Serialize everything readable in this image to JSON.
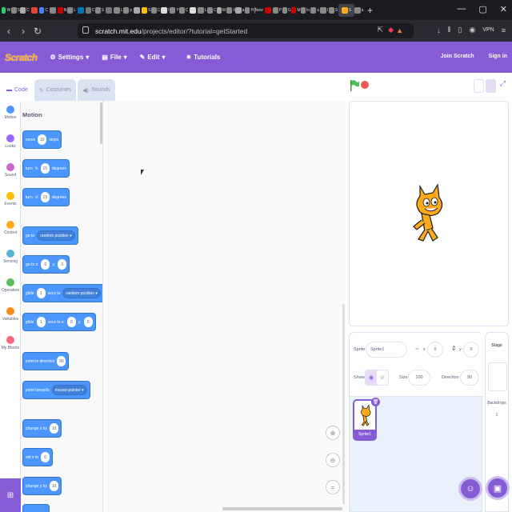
{
  "browser": {
    "tabs": [
      {
        "icon": "whatsapp-icon",
        "color": "#25d366",
        "label": "W"
      },
      {
        "icon": "tab-icon",
        "color": "#888888",
        "label": "S"
      },
      {
        "icon": "tab-icon",
        "color": "#aaaaaa",
        "label": "C"
      },
      {
        "icon": "google-icon",
        "color": "#ea4335",
        "label": ""
      },
      {
        "icon": "tab-icon",
        "color": "#4285f4",
        "label": "C"
      },
      {
        "icon": "tab-icon",
        "color": "#888888",
        "label": ""
      },
      {
        "icon": "tab-icon",
        "color": "#cc0000",
        "label": "N"
      },
      {
        "icon": "tab-icon",
        "color": "#888888",
        "label": "L"
      },
      {
        "icon": "tab-icon",
        "color": "#0077b5",
        "label": ""
      },
      {
        "icon": "tab-icon",
        "color": "#777777",
        "label": "C"
      },
      {
        "icon": "tab-icon",
        "color": "#888888",
        "label": "S"
      },
      {
        "icon": "tab-icon",
        "color": "#777777",
        "label": ""
      },
      {
        "icon": "tab-icon",
        "color": "#888888",
        "label": "L"
      },
      {
        "icon": "tab-icon",
        "color": "#888888",
        "label": "p"
      },
      {
        "icon": "tab-icon",
        "color": "#aaaaaa",
        "label": ""
      },
      {
        "icon": "tab-icon",
        "color": "#f7c600",
        "label": "S"
      },
      {
        "icon": "tab-icon",
        "color": "#888888",
        "label": "C"
      },
      {
        "icon": "tab-icon",
        "color": "#dddddd",
        "label": "I"
      },
      {
        "icon": "tab-icon",
        "color": "#888888",
        "label": "Y"
      },
      {
        "icon": "tab-icon",
        "color": "#888888",
        "label": "C"
      },
      {
        "icon": "github-icon",
        "color": "#dddddd",
        "label": ""
      },
      {
        "icon": "tab-icon",
        "color": "#888888",
        "label": "L"
      },
      {
        "icon": "tab-icon",
        "color": "#888888",
        "label": "C"
      },
      {
        "icon": "tab-icon",
        "color": "#aaaaaa",
        "label": "M"
      },
      {
        "icon": "tab-icon",
        "color": "#888888",
        "label": "li"
      },
      {
        "icon": "tab-icon",
        "color": "#aaaaaa",
        "label": "a"
      },
      {
        "icon": "tab-icon",
        "color": "#888888",
        "label": "H"
      },
      {
        "icon": "tab-icon",
        "color": "#888888",
        "label": "New"
      },
      {
        "icon": "tab-icon",
        "color": "#cc0000",
        "label": ""
      },
      {
        "icon": "tab-icon",
        "color": "#888888",
        "label": "P"
      },
      {
        "icon": "tab-icon",
        "color": "#888888",
        "label": "G"
      },
      {
        "icon": "tab-icon",
        "color": "#cc0000",
        "label": "M"
      },
      {
        "icon": "tab-icon",
        "color": "#888888",
        "label": "In"
      },
      {
        "icon": "tab-icon",
        "color": "#888888",
        "label": "a"
      },
      {
        "icon": "tab-icon",
        "color": "#888888",
        "label": "I"
      },
      {
        "icon": "tab-icon",
        "color": "#888888",
        "label": "S"
      }
    ],
    "active_tab": {
      "icon": "scratch-icon",
      "color": "#ffab19",
      "label": "S"
    },
    "after_tabs": [
      {
        "icon": "tab-icon",
        "color": "#888888",
        "label": "a"
      }
    ],
    "new_tab": "+",
    "url_domain": "scratch.mit.edu",
    "url_path": "/projects/editor/?tutorial=getStarted",
    "vpn": "VPN"
  },
  "menubar": {
    "logo": "Scratch",
    "settings": "Settings",
    "file": "File",
    "edit": "Edit",
    "tutorials": "Tutorials",
    "join": "Join Scratch",
    "signin": "Sign in"
  },
  "editor_tabs": {
    "code": "Code",
    "costumes": "Costumes",
    "sounds": "Sounds"
  },
  "categories": [
    {
      "label": "Motion",
      "color": "#4c97ff"
    },
    {
      "label": "Looks",
      "color": "#9966ff"
    },
    {
      "label": "Sound",
      "color": "#cf63cf"
    },
    {
      "label": "Events",
      "color": "#ffbf00"
    },
    {
      "label": "Control",
      "color": "#ffab19"
    },
    {
      "label": "Sensing",
      "color": "#5cb1d6"
    },
    {
      "label": "Operators",
      "color": "#59c059"
    },
    {
      "label": "Variables",
      "color": "#ff8c1a"
    },
    {
      "label": "My Blocks",
      "color": "#ff6680"
    }
  ],
  "palette": {
    "title": "Motion",
    "move": {
      "a": "move",
      "n": "10",
      "b": "steps"
    },
    "turn_right": {
      "a": "turn",
      "n": "15",
      "b": "degrees"
    },
    "turn_left": {
      "a": "turn",
      "n": "15",
      "b": "degrees"
    },
    "goto": {
      "a": "go to",
      "dd": "random position ▾"
    },
    "goto_xy": {
      "a": "go to x:",
      "x": "0",
      "b": "y:",
      "y": "0"
    },
    "glide_to": {
      "a": "glide",
      "n": "1",
      "b": "secs to",
      "dd": "random position ▾"
    },
    "glide_xy": {
      "a": "glide",
      "n": "1",
      "b": "secs to x:",
      "x": "0",
      "c": "y:",
      "y": "0"
    },
    "point_dir": {
      "a": "point in direction",
      "n": "90"
    },
    "point_towards": {
      "a": "point towards",
      "dd": "mouse-pointer ▾"
    },
    "change_x": {
      "a": "change x by",
      "n": "10"
    },
    "set_x": {
      "a": "set x to",
      "n": "0"
    },
    "change_y": {
      "a": "change y by",
      "n": "10"
    }
  },
  "sprite_info": {
    "sprite_label": "Sprite",
    "sprite_name": "Sprite1",
    "x_label": "x",
    "x": "0",
    "y_label": "y",
    "y": "0",
    "show_label": "Show",
    "size_label": "Size",
    "size": "100",
    "direction_label": "Direction",
    "direction": "90"
  },
  "sprites": [
    {
      "name": "Sprite1"
    }
  ],
  "stage_col": {
    "title": "Stage",
    "backdrops_label": "Backdrops",
    "backdrops_count": "1"
  }
}
